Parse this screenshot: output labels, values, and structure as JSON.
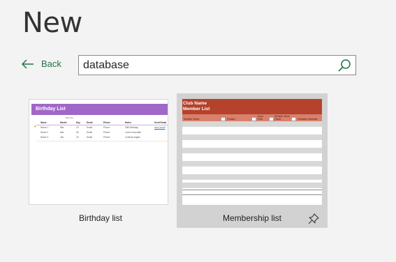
{
  "page": {
    "title": "New"
  },
  "nav": {
    "back_label": "Back"
  },
  "search": {
    "value": "database"
  },
  "colors": {
    "accent": "#217346",
    "birthday_banner": "#a167c6",
    "membership_banner": "#b5422c",
    "membership_header": "#d9806b"
  },
  "templates": [
    {
      "label": "Birthday list",
      "thumbnail": {
        "title": "Birthday List",
        "subheading": "Birthday",
        "columns": [
          "Name",
          "Month",
          "Day",
          "Email",
          "Phone",
          "Notes",
          "Send Email"
        ],
        "rows": [
          [
            "Name 1",
            "Mar",
            "19",
            "Email",
            "Phone",
            "30th Birthday",
            "send email"
          ],
          [
            "Name 2",
            "Mar",
            "28",
            "Email",
            "Phone",
            "Loves chocolate",
            ""
          ],
          [
            "Name 3",
            "Jan",
            "23",
            "Email",
            "Phone",
            "Collects angels",
            ""
          ]
        ]
      }
    },
    {
      "label": "Membership list",
      "selected": true,
      "thumbnail": {
        "title_line1": "Club Name",
        "title_line2": "Member List",
        "columns": [
          "Member Name",
          "Position",
          "Dues Paid",
          "Member Since (Year)",
          "Volunteer Interests"
        ]
      }
    }
  ],
  "icons": {
    "back": "arrow-left-icon",
    "search": "search-icon",
    "pin": "pin-icon"
  }
}
